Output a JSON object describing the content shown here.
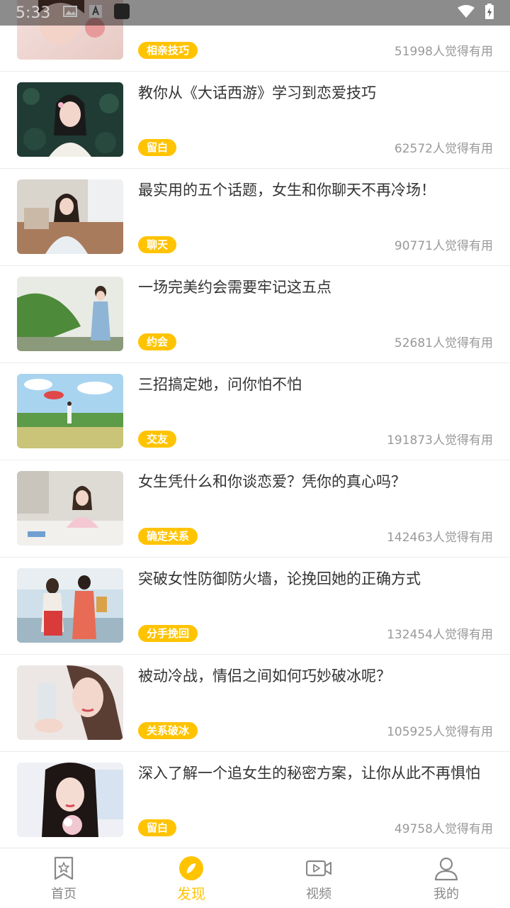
{
  "status_bar": {
    "time": "5:33"
  },
  "colors": {
    "accent": "#FFC300",
    "text": "#333333",
    "muted": "#999999"
  },
  "articles": [
    {
      "title": "",
      "tag": "相亲技巧",
      "useful": "51998人觉得有用"
    },
    {
      "title": "教你从《大话西游》学习到恋爱技巧",
      "tag": "留白",
      "useful": "62572人觉得有用"
    },
    {
      "title": "最实用的五个话题，女生和你聊天不再冷场！",
      "tag": "聊天",
      "useful": "90771人觉得有用"
    },
    {
      "title": "一场完美约会需要牢记这五点",
      "tag": "约会",
      "useful": "52681人觉得有用"
    },
    {
      "title": "三招搞定她，问你怕不怕",
      "tag": "交友",
      "useful": "191873人觉得有用"
    },
    {
      "title": "女生凭什么和你谈恋爱？凭你的真心吗？",
      "tag": "确定关系",
      "useful": "142463人觉得有用"
    },
    {
      "title": "突破女性防御防火墙，论挽回她的正确方式",
      "tag": "分手挽回",
      "useful": "132454人觉得有用"
    },
    {
      "title": "被动冷战，情侣之间如何巧妙破冰呢？",
      "tag": "关系破冰",
      "useful": "105925人觉得有用"
    },
    {
      "title": "深入了解一个追女生的秘密方案，让你从此不再惧怕",
      "tag": "留白",
      "useful": "49758人觉得有用"
    }
  ],
  "tabbar": {
    "tabs": [
      {
        "label": "首页",
        "icon": "bookmark-star-icon",
        "active": false
      },
      {
        "label": "发现",
        "icon": "compass-icon",
        "active": true
      },
      {
        "label": "视频",
        "icon": "video-camera-icon",
        "active": false
      },
      {
        "label": "我的",
        "icon": "user-icon",
        "active": false
      }
    ]
  }
}
